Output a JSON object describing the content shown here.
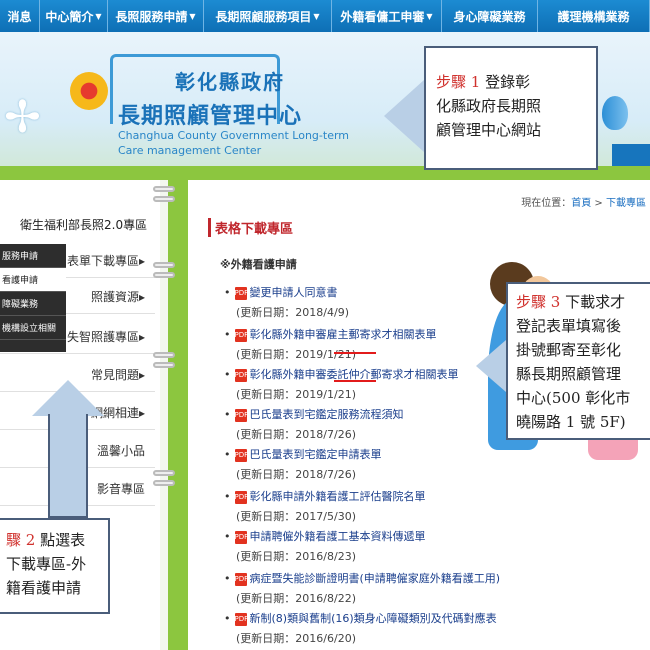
{
  "nav": {
    "items": [
      {
        "label": "消息",
        "caret": false
      },
      {
        "label": "中心簡介",
        "caret": true
      },
      {
        "label": "長照服務申請",
        "caret": true
      },
      {
        "label": "長期照顧服務項目",
        "caret": true
      },
      {
        "label": "外籍看傭工申審",
        "caret": true
      },
      {
        "label": "身心障礙業務",
        "caret": false
      },
      {
        "label": "護理機構業務",
        "caret": false
      }
    ]
  },
  "banner": {
    "title_line1": "彰化縣政府",
    "title_line2": "長期照顧管理中心",
    "title_en_line1": "Changhua County Government Long-term",
    "title_en_line2": "Care management Center"
  },
  "callouts": {
    "step1": {
      "step": "步驟 1",
      "text_line1": " 登錄彰",
      "text_line2": "化縣政府長期照",
      "text_line3": "顧管理中心網站"
    },
    "step2": {
      "step": "驟 2",
      "text_line1": " 點選表",
      "text_line2": "下載專區-外",
      "text_line3": "籍看護申請"
    },
    "step3": {
      "step": "步驟 3",
      "text_line1": " 下載求才",
      "text_line2": "登記表單填寫後",
      "text_line3": "掛號郵寄至彰化",
      "text_line4": "縣長期照顧管理",
      "text_line5": "中心(500 彰化市",
      "text_line6": "曉陽路 1 號 5F)"
    }
  },
  "sidebar": {
    "header": "衛生福利部長照2.0專區",
    "submenu": [
      {
        "label": "服務申請",
        "active": false
      },
      {
        "label": "看護申請",
        "active": true
      },
      {
        "label": "障礙業務",
        "active": false
      },
      {
        "label": "機構設立相關",
        "active": false
      }
    ],
    "items": [
      {
        "label": "表單下載專區",
        "caret": true
      },
      {
        "label": "照護資源",
        "caret": true
      },
      {
        "label": "失智照護專區",
        "caret": true
      },
      {
        "label": "常見問題",
        "caret": true
      },
      {
        "label": "網網相連",
        "caret": true
      },
      {
        "label": "溫馨小品",
        "caret": false
      },
      {
        "label": "影音專區",
        "caret": false
      }
    ]
  },
  "content": {
    "breadcrumb": {
      "prefix": "現在位置：",
      "home": "首頁",
      "sep": " > ",
      "current": "下載專區"
    },
    "title": "表格下載專區",
    "section": "※外籍看護申請",
    "docs": [
      {
        "title": "變更申請人同意書",
        "updated": "(更新日期：2018/4/9)"
      },
      {
        "title": "彰化縣外籍申審雇主郵寄求才相關表單",
        "updated": "(更新日期：2019/1/21)"
      },
      {
        "title": "彰化縣外籍申審委託仲介郵寄求才相關表單",
        "updated": "(更新日期：2019/1/21)"
      },
      {
        "title": "巴氏量表到宅鑑定服務流程須知",
        "updated": "(更新日期：2018/7/26)"
      },
      {
        "title": "巴氏量表到宅鑑定申請表單",
        "updated": "(更新日期：2018/7/26)"
      },
      {
        "title": "彰化縣申請外籍看護工評估醫院名單",
        "updated": "(更新日期：2017/5/30)"
      },
      {
        "title": "申請聘僱外籍看護工基本資料傳遞單",
        "updated": "(更新日期：2016/8/23)"
      },
      {
        "title": "病症暨失能診斷證明書(申請聘僱家庭外籍看護工用)",
        "updated": "(更新日期：2016/8/22)"
      },
      {
        "title": "新制(8)類與舊制(16)類身心障礙類別及代碼對應表",
        "updated": "(更新日期：2016/6/20)"
      }
    ]
  },
  "icons": {
    "pdf": "pdf-file-icon",
    "caret": "caret-right-icon"
  },
  "colors": {
    "nav": "#1c8bd2",
    "accent_red": "#d0312d",
    "green": "#8cc63f",
    "link": "#1a3e8c"
  }
}
